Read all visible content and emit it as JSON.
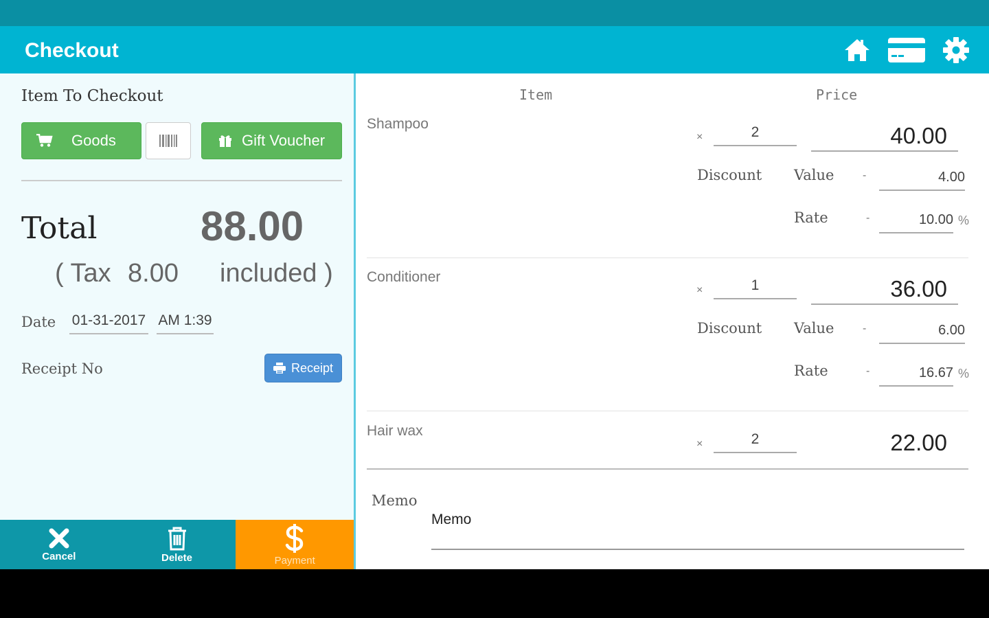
{
  "appbar": {
    "title": "Checkout",
    "icons": [
      "home-icon",
      "credit-card-icon",
      "gear-icon"
    ]
  },
  "left": {
    "section_title": "Item To Checkout",
    "goods_label": "Goods",
    "gift_voucher_label": "Gift Voucher",
    "total_label": "Total",
    "total_value": "88.00",
    "tax_prefix": "( Tax",
    "tax_value": "8.00",
    "tax_suffix": "included )",
    "date_label": "Date",
    "date_value": "01-31-2017",
    "time_value": "AM 1:39",
    "receipt_no_label": "Receipt No",
    "receipt_button_label": "Receipt"
  },
  "actions": {
    "cancel_label": "Cancel",
    "delete_label": "Delete",
    "payment_label": "Payment"
  },
  "table": {
    "col_item": "Item",
    "col_price": "Price",
    "times_symbol": "×",
    "discount_label": "Discount",
    "value_label": "Value",
    "rate_label": "Rate",
    "minus_symbol": "-",
    "percent_symbol": "%",
    "items": [
      {
        "name": "Shampoo",
        "qty": "2",
        "price": "40.00",
        "discount_value": "4.00",
        "discount_rate": "10.00"
      },
      {
        "name": "Conditioner",
        "qty": "1",
        "price": "36.00",
        "discount_value": "6.00",
        "discount_rate": "16.67"
      },
      {
        "name": "Hair wax",
        "qty": "2",
        "price": "22.00"
      }
    ]
  },
  "memo": {
    "label": "Memo",
    "placeholder": "Memo"
  },
  "colors": {
    "statusbar": "#0a8fa3",
    "appbar": "#00b4d2",
    "green": "#5cb85c",
    "blue": "#4a90d6",
    "action_teal": "#0e97a8",
    "payment_orange": "#ff9800"
  }
}
